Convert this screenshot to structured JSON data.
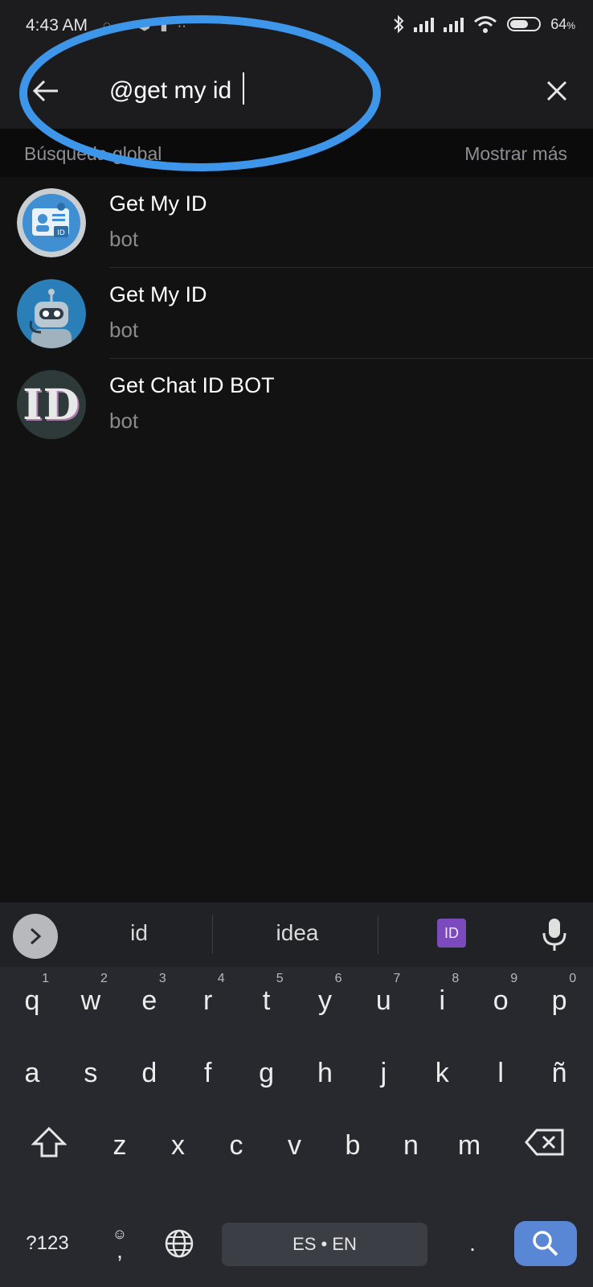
{
  "status_bar": {
    "time": "4:43 AM",
    "battery_percent": "64",
    "battery_unit": "%",
    "battery_level": 0.64
  },
  "search": {
    "query": "@get my id"
  },
  "section": {
    "title": "Búsqueda global",
    "show_more": "Mostrar más"
  },
  "results": [
    {
      "title": "Get My ID",
      "subtitle": "bot",
      "avatar": "id-card-icon"
    },
    {
      "title": "Get My ID",
      "subtitle": "bot",
      "avatar": "robot-icon"
    },
    {
      "title": "Get Chat ID BOT",
      "subtitle": "bot",
      "avatar_text": "ID"
    }
  ],
  "keyboard": {
    "suggestions": [
      "id",
      "idea"
    ],
    "emoji_suggestion": "ID",
    "row1": [
      {
        "key": "q",
        "num": "1"
      },
      {
        "key": "w",
        "num": "2"
      },
      {
        "key": "e",
        "num": "3"
      },
      {
        "key": "r",
        "num": "4"
      },
      {
        "key": "t",
        "num": "5"
      },
      {
        "key": "y",
        "num": "6"
      },
      {
        "key": "u",
        "num": "7"
      },
      {
        "key": "i",
        "num": "8"
      },
      {
        "key": "o",
        "num": "9"
      },
      {
        "key": "p",
        "num": "0"
      }
    ],
    "row2": [
      "a",
      "s",
      "d",
      "f",
      "g",
      "h",
      "j",
      "k",
      "l",
      "ñ"
    ],
    "row3": [
      "z",
      "x",
      "c",
      "v",
      "b",
      "n",
      "m"
    ],
    "symbols_label": "?123",
    "comma_label": ",",
    "space_label": "ES • EN",
    "period_label": "."
  },
  "colors": {
    "accent_annotation": "#3d96ea",
    "search_key": "#5a86d6"
  }
}
